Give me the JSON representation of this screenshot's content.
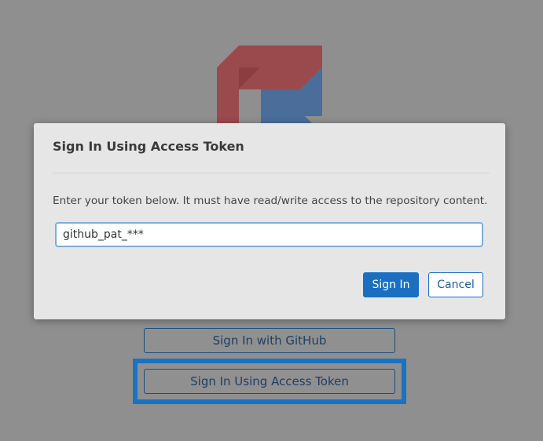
{
  "background": {
    "logo": "app-logo",
    "github_button_label": "Sign In with GitHub",
    "token_button_label": "Sign In Using Access Token"
  },
  "modal": {
    "title": "Sign In Using Access Token",
    "description": "Enter your token below. It must have read/write access to the repository content.",
    "token_input_value": "github_pat_***",
    "signin_label": "Sign In",
    "cancel_label": "Cancel"
  },
  "colors": {
    "accent": "#1a6fc1",
    "logo_red": "#b8252a",
    "logo_blue": "#2b6cb5",
    "overlay": "#8f8f8f"
  }
}
